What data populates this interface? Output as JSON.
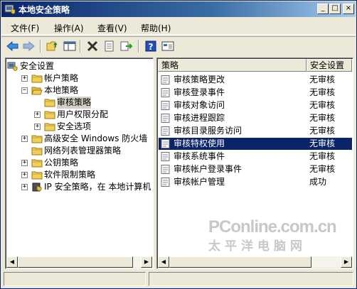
{
  "window": {
    "title": "本地安全策略"
  },
  "title_buttons": {
    "minimize": "_",
    "maximize": "□",
    "close": "×"
  },
  "menu": [
    "文件(F)",
    "操作(A)",
    "查看(V)",
    "帮助(H)"
  ],
  "toolbar_icons": [
    "back-arrow-icon",
    "forward-arrow-icon",
    "up-folder-icon",
    "show-tree-icon",
    "delete-icon",
    "properties-icon",
    "export-list-icon",
    "help-icon",
    "console-view-icon"
  ],
  "tree": [
    {
      "label": "安全设置",
      "depth": 0,
      "expander": "",
      "icon": "computer-shield-icon"
    },
    {
      "label": "帐户策略",
      "depth": 1,
      "expander": "+",
      "icon": "folder-icon"
    },
    {
      "label": "本地策略",
      "depth": 1,
      "expander": "−",
      "icon": "folder-open-icon"
    },
    {
      "label": "审核策略",
      "depth": 2,
      "expander": "",
      "icon": "folder-icon",
      "selected": true
    },
    {
      "label": "用户权限分配",
      "depth": 2,
      "expander": "+",
      "icon": "folder-icon"
    },
    {
      "label": "安全选项",
      "depth": 2,
      "expander": "+",
      "icon": "folder-icon"
    },
    {
      "label": "高级安全 Windows 防火墙",
      "depth": 1,
      "expander": "+",
      "icon": "folder-icon"
    },
    {
      "label": "网络列表管理器策略",
      "depth": 1,
      "expander": "",
      "icon": "folder-icon"
    },
    {
      "label": "公钥策略",
      "depth": 1,
      "expander": "+",
      "icon": "folder-icon"
    },
    {
      "label": "软件限制策略",
      "depth": 1,
      "expander": "+",
      "icon": "folder-icon"
    },
    {
      "label": "IP 安全策略，在 本地计算机",
      "depth": 1,
      "expander": "+",
      "icon": "ip-security-icon"
    }
  ],
  "list": {
    "columns": [
      "策略",
      "安全设置"
    ],
    "rows": [
      {
        "policy": "审核策略更改",
        "setting": "无审核"
      },
      {
        "policy": "审核登录事件",
        "setting": "无审核"
      },
      {
        "policy": "审核对象访问",
        "setting": "无审核"
      },
      {
        "policy": "审核进程跟踪",
        "setting": "无审核"
      },
      {
        "policy": "审核目录服务访问",
        "setting": "无审核"
      },
      {
        "policy": "审核特权使用",
        "setting": "无审核",
        "selected": true
      },
      {
        "policy": "审核系统事件",
        "setting": "无审核"
      },
      {
        "policy": "审核帐户登录事件",
        "setting": "无审核"
      },
      {
        "policy": "审核帐户管理",
        "setting": "成功"
      }
    ]
  },
  "watermark": {
    "brand": "PConline.com.cn",
    "tagline": "太平洋电脑网"
  },
  "colors": {
    "selection": "#0a246a",
    "titlebar": "#0a246a",
    "face": "#ece9d8"
  }
}
